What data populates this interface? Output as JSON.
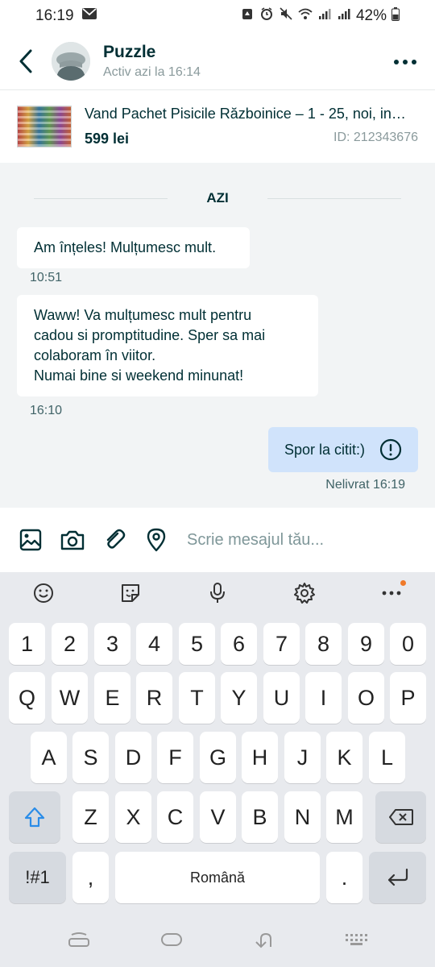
{
  "status_bar": {
    "time": "16:19",
    "battery": "42%"
  },
  "header": {
    "contact_name": "Puzzle",
    "contact_status": "Activ azi la 16:14"
  },
  "listing": {
    "title": "Vand Pachet Pisicile Războinice – 1 - 25, noi, in…",
    "price": "599 lei",
    "id": "ID: 212343676"
  },
  "chat": {
    "day_label": "AZI",
    "messages": [
      {
        "text": "Am înțeles! Mulțumesc mult.",
        "time": "10:51",
        "direction": "incoming"
      },
      {
        "text": "Waww!  Va mulțumesc mult pentru\ncadou si promptitudine.  Sper sa mai\ncolaboram în viitor.\nNumai bine si weekend minunat!",
        "time": "16:10",
        "direction": "incoming"
      },
      {
        "text": "Spor la citit:)",
        "status_time": "Nelivrat 16:19",
        "direction": "outgoing"
      }
    ]
  },
  "composer": {
    "placeholder": "Scrie mesajul tău..."
  },
  "keyboard": {
    "row_numbers": [
      "1",
      "2",
      "3",
      "4",
      "5",
      "6",
      "7",
      "8",
      "9",
      "0"
    ],
    "row_top": [
      "Q",
      "W",
      "E",
      "R",
      "T",
      "Y",
      "U",
      "I",
      "O",
      "P"
    ],
    "row_mid": [
      "A",
      "S",
      "D",
      "F",
      "G",
      "H",
      "J",
      "K",
      "L"
    ],
    "row_bot": [
      "Z",
      "X",
      "C",
      "V",
      "B",
      "N",
      "M"
    ],
    "symbols_key": "!#1",
    "comma_key": ",",
    "space_label": "Română",
    "period_key": "."
  },
  "colors": {
    "accent": "#002f34",
    "chat_bg": "#f2f4f5",
    "outgoing_bubble": "#d0e3fb",
    "keyboard_bg": "#e8eaee",
    "notification_dot": "#f07a2a"
  }
}
